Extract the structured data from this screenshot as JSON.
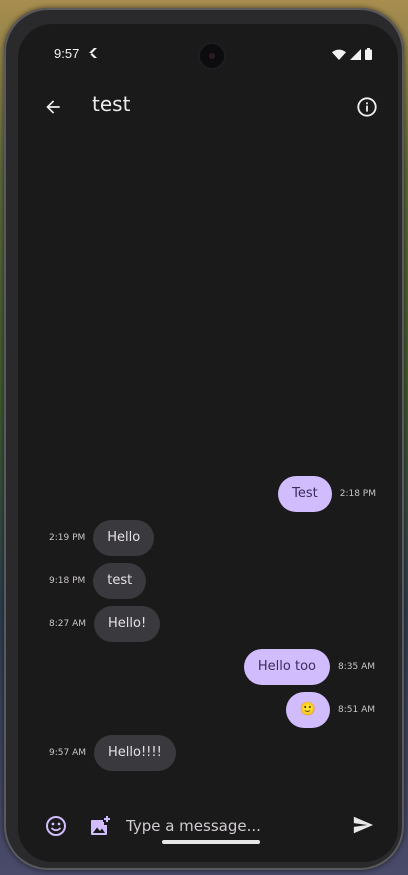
{
  "status_bar": {
    "time": "9:57"
  },
  "header": {
    "title": "test"
  },
  "messages": [
    {
      "direction": "out",
      "text": "Test",
      "time": "2:18 PM"
    },
    {
      "direction": "in",
      "text": "Hello",
      "time": "2:19 PM"
    },
    {
      "direction": "in",
      "text": "test",
      "time": "9:18 PM"
    },
    {
      "direction": "in",
      "text": "Hello!",
      "time": "8:27 AM"
    },
    {
      "direction": "out",
      "text": "Hello too",
      "time": "8:35 AM"
    },
    {
      "direction": "out",
      "text": "🙂",
      "time": "8:51 AM"
    },
    {
      "direction": "in",
      "text": "Hello!!!!",
      "time": "9:57 AM"
    }
  ],
  "composer": {
    "placeholder": "Type a message..."
  },
  "icons": {
    "back": "arrow-back-icon",
    "info": "info-icon",
    "emoji": "emoji-icon",
    "add_image": "add-photo-icon",
    "send": "send-icon"
  },
  "colors": {
    "background": "#1b1a1b",
    "incoming_bubble": "#3a393d",
    "outgoing_bubble": "#d1bcfd",
    "accent": "#d1bcfd"
  }
}
